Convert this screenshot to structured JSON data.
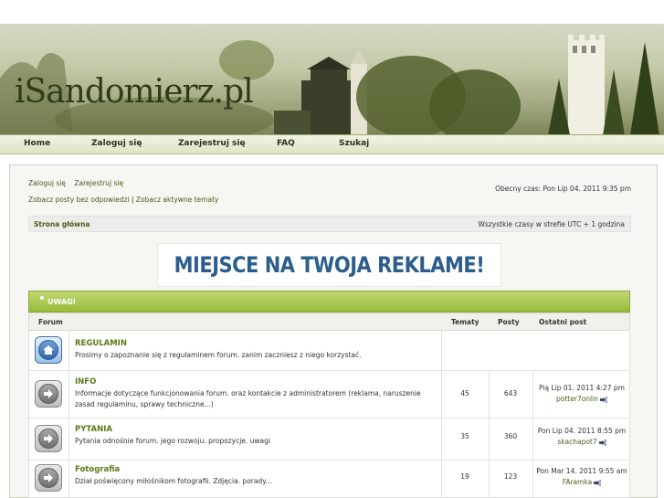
{
  "header": {
    "logo_text": "iSandomierz.pl"
  },
  "nav": {
    "items": [
      "Home",
      "Zaloguj się",
      "Zarejestruj się",
      "FAQ",
      "Szukaj"
    ]
  },
  "toplinks": {
    "login": "Zaloguj się",
    "register": "Zarejestruj się"
  },
  "links": {
    "unanswered": "Zobacz posty bez odpowiedzi",
    "separator": "|",
    "active": "Zobacz aktywne tematy"
  },
  "current_time": "Obecny czas: Pon Lip 04. 2011 9:35 pm",
  "strip": {
    "home": "Strona główna",
    "timezone": "Wszystkie czasy w strefie UTC + 1 godzina"
  },
  "ad": {
    "text": "MIEJSCE NA TWOJA REKLAME!"
  },
  "category": {
    "title": "UWAGI"
  },
  "columns": {
    "forum": "Forum",
    "topics": "Tematy",
    "posts": "Posty",
    "last_post": "Ostatni post"
  },
  "forums": [
    {
      "name": "REGULAMIN",
      "description": "Prosimy o zapoznanie się z regulaminem forum. zanim zaczniesz z niego korzystać.",
      "topics": "",
      "posts": "",
      "last_date": "",
      "last_user": "",
      "icon": "home-icon"
    },
    {
      "name": "INFO",
      "description": "Informacje dotyczące funkcjonowania forum. oraz kontakcie z administratorem (reklama, naruszenie zasad regulaminu, sprawy techniczne...)",
      "topics": "45",
      "posts": "643",
      "last_date": "Pią Lip 01. 2011 4:27 pm",
      "last_user": "potter7onlin",
      "icon": "arrow-right-icon"
    },
    {
      "name": "PYTANIA",
      "description": "Pytania odnośnie forum. jego rozwoju. propozycje. uwagi",
      "topics": "35",
      "posts": "360",
      "last_date": "Pon Lip 04. 2011 8:55 pm",
      "last_user": "skachapot7",
      "icon": "arrow-right-icon"
    },
    {
      "name": "Fotografia",
      "description": "Dział poświęcony miłośnikom fotografii. Zdjęcia. porady...",
      "topics": "19",
      "posts": "123",
      "last_date": "Pon Mar 14. 2011 9:55 am",
      "last_user": "FAramka",
      "icon": "arrow-right-icon"
    }
  ],
  "colors": {
    "accent_green": "#98bb3a",
    "link_green": "#5c7a16",
    "ad_blue": "#2b5e8c"
  }
}
